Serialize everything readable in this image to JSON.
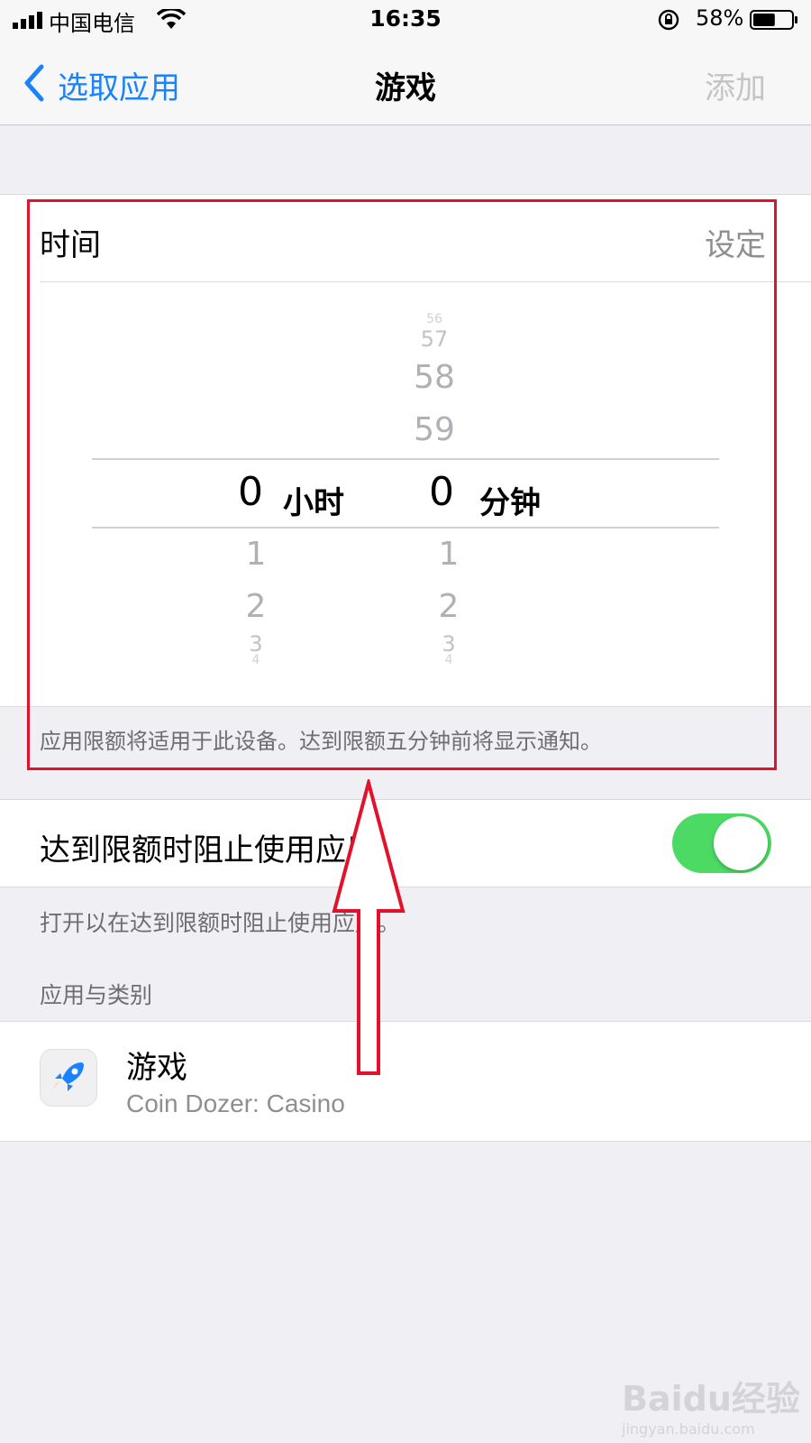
{
  "status_bar": {
    "carrier": "中国电信",
    "time": "16:35",
    "battery_percent": "58%",
    "battery_level": 0.58
  },
  "nav": {
    "back_label": "选取应用",
    "title": "游戏",
    "add_label": "添加"
  },
  "time_section": {
    "label": "时间",
    "value": "设定",
    "picker": {
      "hours": {
        "above": [],
        "selected": "0",
        "unit": "小时",
        "below": [
          "1",
          "2",
          "3",
          "4"
        ]
      },
      "minutes": {
        "above": [
          "56",
          "57",
          "58",
          "59"
        ],
        "selected": "0",
        "unit": "分钟",
        "below": [
          "1",
          "2",
          "3",
          "4"
        ]
      }
    },
    "footer_note": "应用限额将适用于此设备。达到限额五分钟前将显示通知。"
  },
  "block_toggle": {
    "label": "达到限额时阻止使用应用",
    "enabled": true,
    "note": "打开以在达到限额时阻止使用应用。"
  },
  "apps": {
    "header": "应用与类别",
    "items": [
      {
        "name": "游戏",
        "subtitle": "Coin Dozer: Casino",
        "icon": "rocket-icon"
      }
    ]
  },
  "annotation": {
    "color": "#e3112b"
  },
  "watermark": {
    "text": "Baidu经验",
    "url": "jingyan.baidu.com"
  }
}
